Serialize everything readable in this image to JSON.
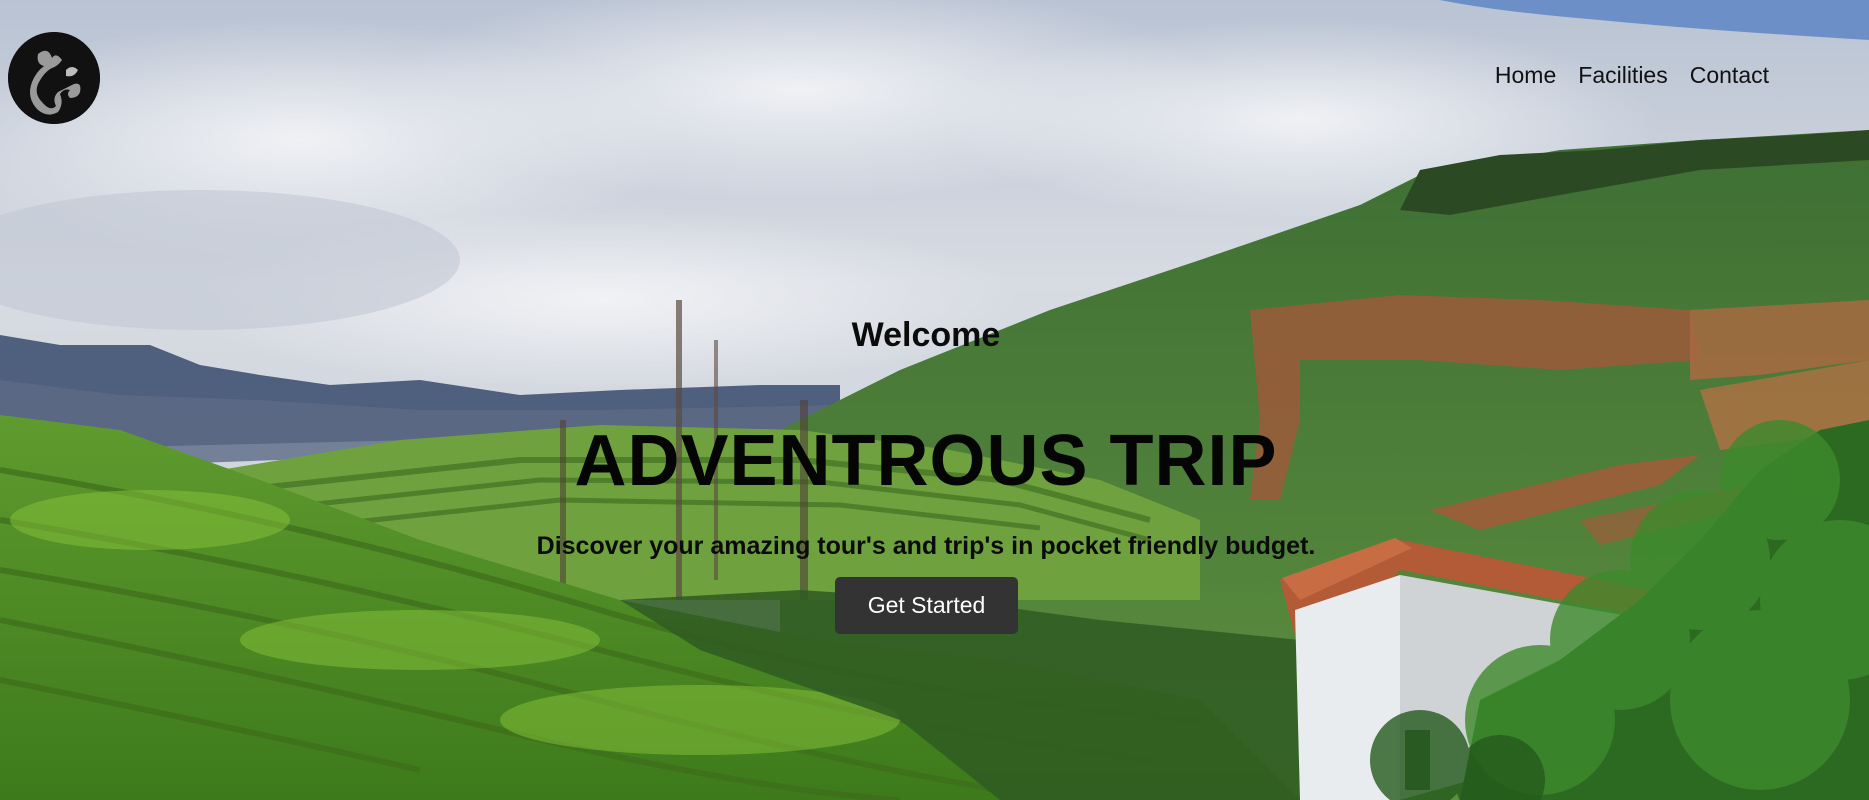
{
  "nav": {
    "items": [
      {
        "label": "Home"
      },
      {
        "label": "Facilities"
      },
      {
        "label": "Contact"
      }
    ]
  },
  "hero": {
    "welcome": "Welcome",
    "headline": "ADVENTROUS TRIP",
    "tagline": "Discover your amazing tour's and trip's in pocket friendly budget.",
    "cta_label": "Get Started"
  },
  "logo": {
    "icon": "stylized-glyph-logo-icon"
  },
  "colors": {
    "button_bg": "#333333",
    "button_text": "#ffffff",
    "text": "#0b0b0b",
    "sky": "#c9cfd8",
    "hills_green": "#4f8a2c"
  }
}
